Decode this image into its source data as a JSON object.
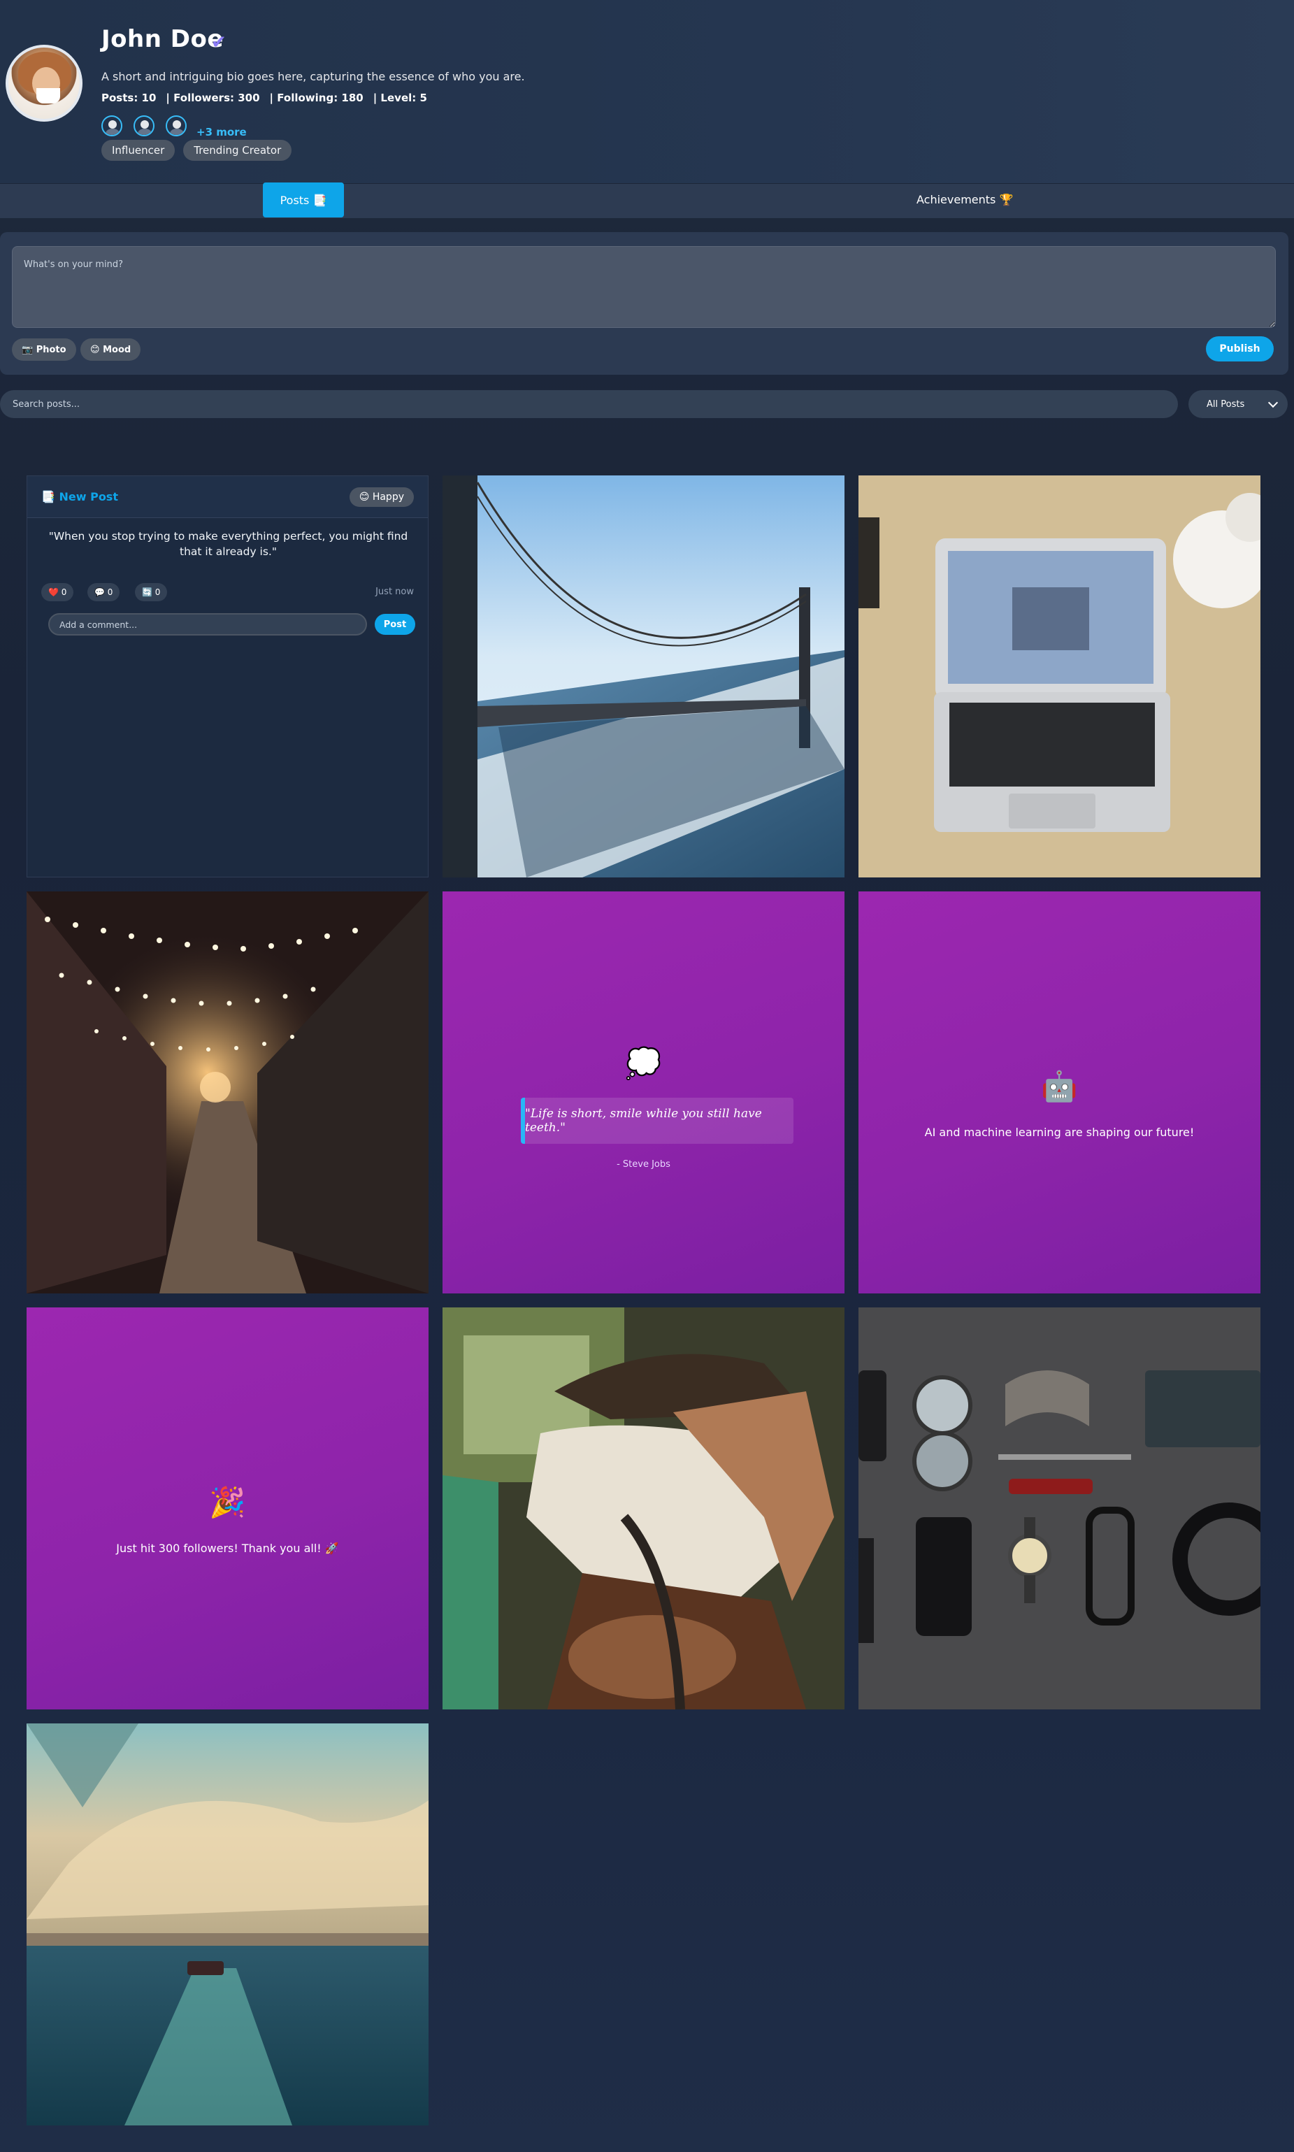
{
  "profile": {
    "name": "John Doe",
    "verified_icon": "✔",
    "bio": "A short and intriguing bio goes here, capturing the essence of who you are.",
    "stats": {
      "posts": "Posts: 10",
      "followers": "| Followers: 300",
      "following": "| Following: 180",
      "level": "| Level: 5"
    },
    "followers_preview_more": "+3 more",
    "badges": [
      "Influencer",
      "Trending Creator"
    ]
  },
  "tabs": {
    "posts": "Posts 📑",
    "achievements": "Achievements 🏆"
  },
  "composer": {
    "placeholder": "What's on your mind?",
    "photo_label": "📷 Photo",
    "mood_label": "😊 Mood",
    "publish_label": "Publish"
  },
  "search": {
    "placeholder": "Search posts...",
    "filter_value": "All Posts"
  },
  "new_post": {
    "title": "📑 New Post",
    "mood": "😊 Happy",
    "text": "\"When you stop trying to make everything perfect, you might find that it already is.\"",
    "likes": "❤️ 0",
    "comments": "💬 0",
    "shares": "🔄 0",
    "time": "Just now",
    "comment_placeholder": "Add a comment...",
    "post_label": "Post"
  },
  "quote_tile": {
    "emoji": "💭",
    "quote": "\"Life is short, smile while you still have teeth.\"",
    "author": "- Steve Jobs"
  },
  "ai_tile": {
    "emoji": "🤖",
    "text": "AI and machine learning are shaping our future!"
  },
  "milestone_tile": {
    "emoji": "🎉",
    "text": "Just hit 300 followers! Thank you all! 🚀"
  },
  "colors": {
    "accent": "#0ea5e9",
    "verified": "#8b7cf6",
    "tile_purple": "#9c27b0"
  }
}
